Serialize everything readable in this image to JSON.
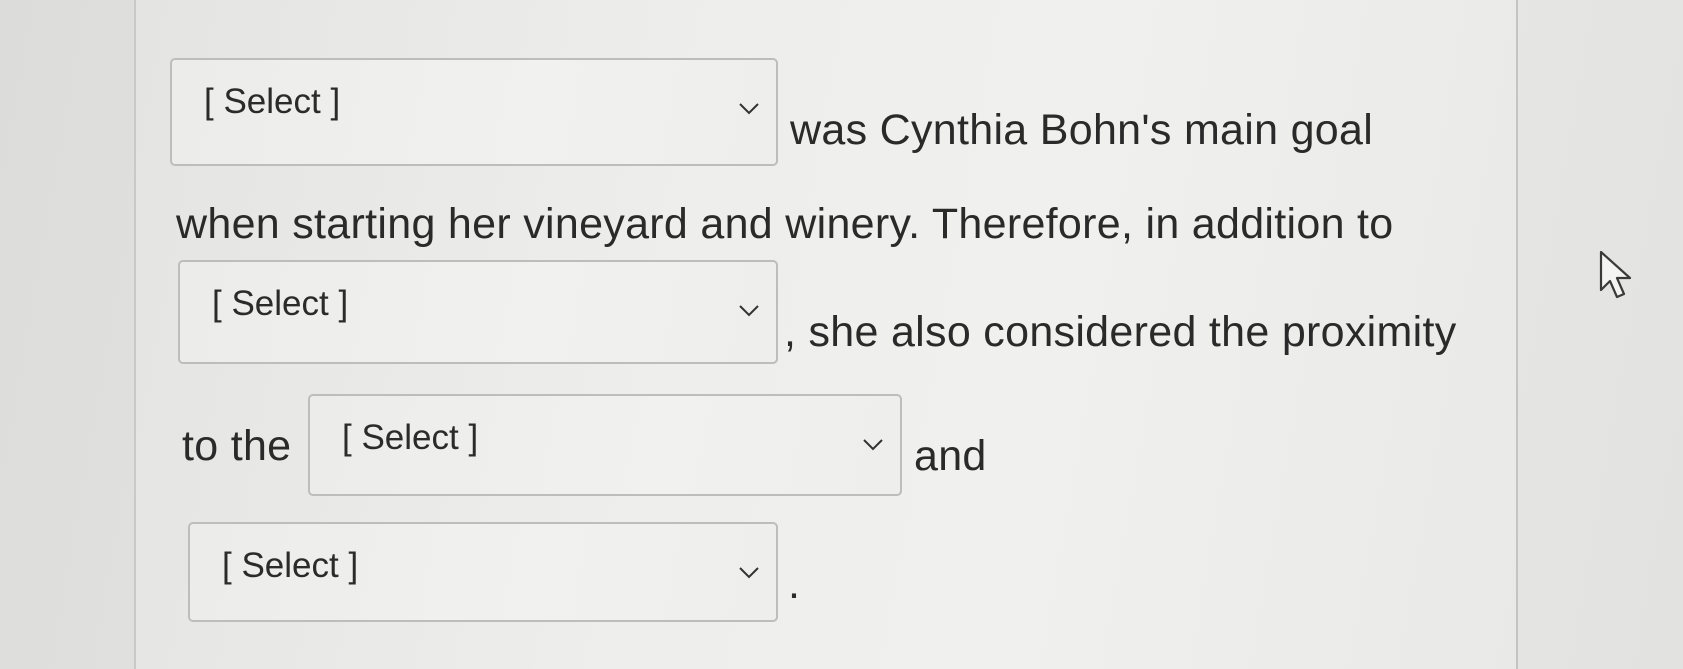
{
  "question": {
    "line1_after": "was Cynthia Bohn's main goal",
    "line2": "when starting her vineyard and winery. Therefore, in addition to",
    "line3_after": ", she also considered the proximity",
    "line4_before": "to the",
    "line4_after": "and",
    "line5_after": "."
  },
  "dropdowns": {
    "d1": "[ Select ]",
    "d2": "[ Select ]",
    "d3": "[ Select ]",
    "d4": "[ Select ]"
  },
  "icons": {
    "chevron": "chevron-down-icon",
    "cursor": "mouse-pointer-icon"
  }
}
